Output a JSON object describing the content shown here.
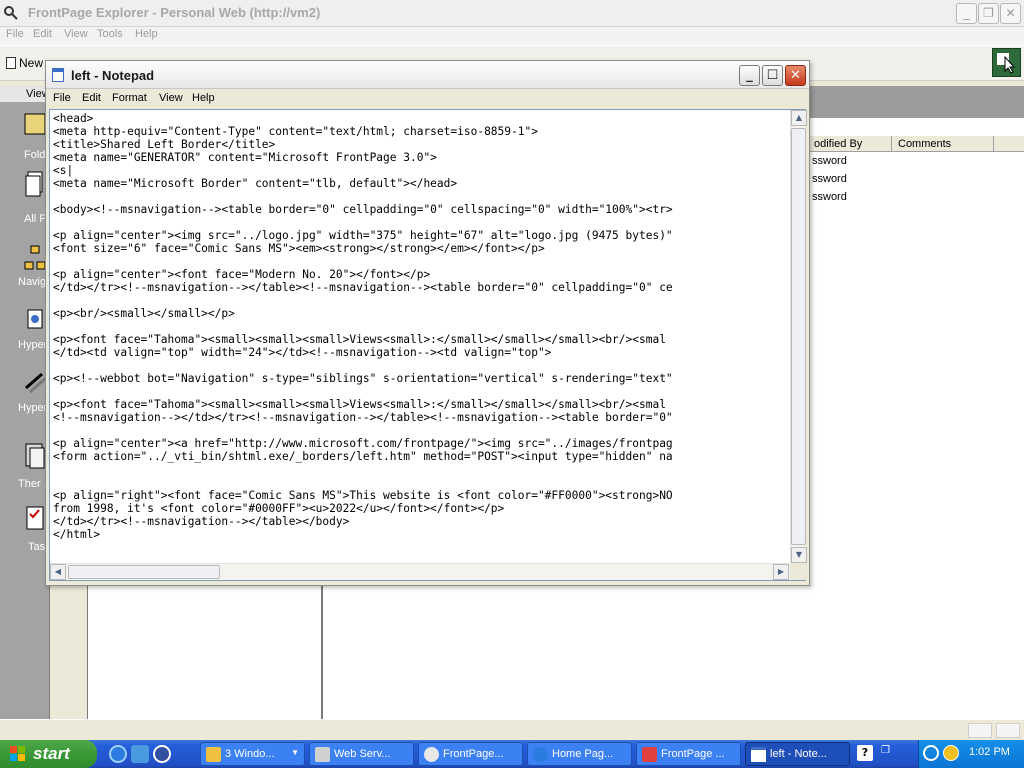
{
  "explorer": {
    "title": "FrontPage Explorer - Personal Web (http://vm2)",
    "menus": [
      "File",
      "Edit",
      "View",
      "Tools",
      "Help"
    ],
    "toolbar_new": "New",
    "views_header": "View",
    "sidebar_items": [
      "Fold",
      "All F",
      "Navig",
      "Hyper",
      "Hyper Stat",
      "Ther",
      "Tas"
    ],
    "columns": [
      "odified By",
      "Comments"
    ],
    "rows": [
      "ssword",
      "ssword",
      "ssword"
    ]
  },
  "notepad": {
    "title": "left - Notepad",
    "menus": [
      "File",
      "Edit",
      "Format",
      "View",
      "Help"
    ],
    "content": "<head>\n<meta http-equiv=\"Content-Type\" content=\"text/html; charset=iso-8859-1\">\n<title>Shared Left Border</title>\n<meta name=\"GENERATOR\" content=\"Microsoft FrontPage 3.0\">\n<s|\n<meta name=\"Microsoft Border\" content=\"tlb, default\"></head>\n\n<body><!--msnavigation--><table border=\"0\" cellpadding=\"0\" cellspacing=\"0\" width=\"100%\"><tr>\n\n<p align=\"center\"><img src=\"../logo.jpg\" width=\"375\" height=\"67\" alt=\"logo.jpg (9475 bytes)\"\n<font size=\"6\" face=\"Comic Sans MS\"><em><strong></strong></em></font></p>\n\n<p align=\"center\"><font face=\"Modern No. 20\"></font></p>\n</td></tr><!--msnavigation--></table><!--msnavigation--><table border=\"0\" cellpadding=\"0\" ce\n\n<p><br/><small></small></p>\n\n<p><font face=\"Tahoma\"><small><small><small>Views<small>:</small></small></small><br/><smal\n</td><td valign=\"top\" width=\"24\"></td><!--msnavigation--><td valign=\"top\">\n\n<p><!--webbot bot=\"Navigation\" s-type=\"siblings\" s-orientation=\"vertical\" s-rendering=\"text\"\n\n<p><font face=\"Tahoma\"><small><small><small>Views<small>:</small></small></small><br/><smal\n<!--msnavigation--></td></tr><!--msnavigation--></table><!--msnavigation--><table border=\"0\"\n\n<p align=\"center\"><a href=\"http://www.microsoft.com/frontpage/\"><img src=\"../images/frontpag\n<form action=\"../_vti_bin/shtml.exe/_borders/left.htm\" method=\"POST\"><input type=\"hidden\" na\n\n\n<p align=\"right\"><font face=\"Comic Sans MS\">This website is <font color=\"#FF0000\"><strong>NO\nfrom 1998, it's <font color=\"#0000FF\"><u>2022</u></font></font></p>\n</td></tr><!--msnavigation--></table></body>\n</html>"
  },
  "taskbar": {
    "start_label": "start",
    "tasks": [
      {
        "label": "3 Windo...",
        "icon": "folder-icon"
      },
      {
        "label": "Web Serv...",
        "icon": "web-server-icon"
      },
      {
        "label": "FrontPage...",
        "icon": "frontpage-icon"
      },
      {
        "label": "Home Pag...",
        "icon": "ie-icon"
      },
      {
        "label": "FrontPage ...",
        "icon": "frontpage-editor-icon"
      },
      {
        "label": "left - Note...",
        "icon": "notepad-icon"
      }
    ],
    "clock": "1:02 PM"
  }
}
